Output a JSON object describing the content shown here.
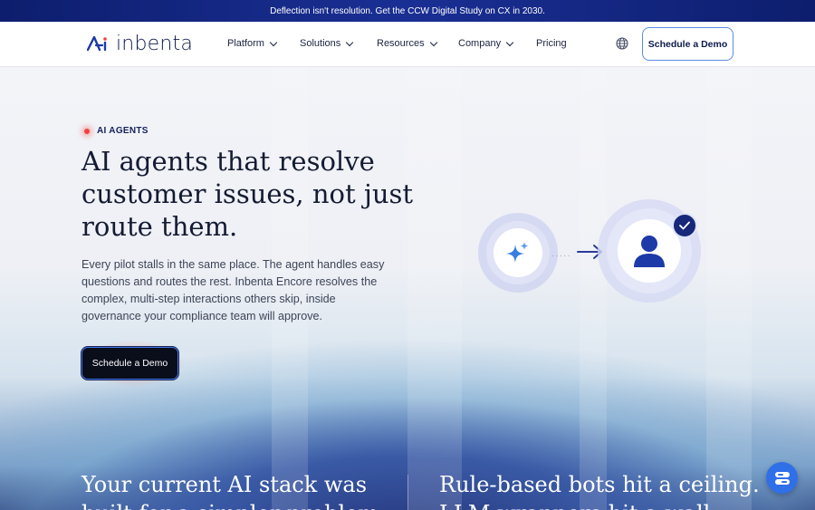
{
  "banner": {
    "text": "Deflection isn't resolution. Get the CCW Digital Study on CX in 2030."
  },
  "nav": {
    "logo_text": "inbenta",
    "items": [
      {
        "label": "Platform",
        "has_dropdown": true
      },
      {
        "label": "Solutions",
        "has_dropdown": true
      },
      {
        "label": "Resources",
        "has_dropdown": true
      },
      {
        "label": "Company",
        "has_dropdown": true
      },
      {
        "label": "Pricing",
        "has_dropdown": false
      }
    ],
    "cta_label": "Schedule a Demo",
    "icons": {
      "language": "globe-icon"
    }
  },
  "hero": {
    "eyebrow": "AI AGENTS",
    "headline_lines": [
      "AI agents that resolve",
      "customer issues, not just",
      "route them."
    ],
    "body_lines": [
      "Every pilot stalls in the same place. The agent handles easy",
      "questions and routes the rest. Inbenta Encore resolves the",
      "complex, multi-step interactions others skip, inside",
      "governance your compliance team will approve."
    ],
    "cta_label": "Schedule a Demo",
    "illustration_icons": [
      "sparkle-icon",
      "arrow-right-icon",
      "user-icon",
      "checkmark-icon"
    ]
  },
  "lower": {
    "left_lines": [
      "Your current AI stack was",
      "built for a simpler problem."
    ],
    "right_lines": [
      "Rule-based bots hit a ceiling.",
      "LLM wrappers hit a wall."
    ]
  },
  "chat_widget": {
    "icon": "chat-icon"
  },
  "colors": {
    "brand_navy": "#0f1a4a",
    "accent_blue": "#3f73e8",
    "alert_red": "#f0403f"
  }
}
